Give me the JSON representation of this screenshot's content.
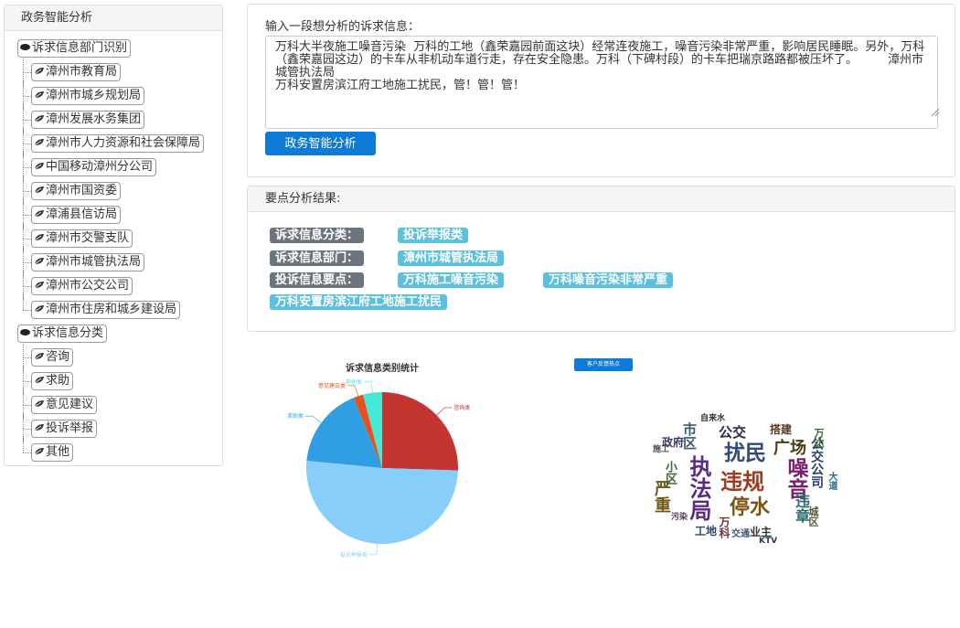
{
  "sidebar": {
    "title": "政务智能分析",
    "groups": [
      {
        "label": "诉求信息部门识别",
        "items": [
          "漳州市教育局",
          "漳州市城乡规划局",
          "漳州发展水务集团",
          "漳州市人力资源和社会保障局",
          "中国移动漳州分公司",
          "漳州市国资委",
          "漳浦县信访局",
          "漳州市交警支队",
          "漳州市城管执法局",
          "漳州市公交公司",
          "漳州市住房和城乡建设局"
        ]
      },
      {
        "label": "诉求信息分类",
        "items": [
          "咨询",
          "求助",
          "意见建议",
          "投诉举报",
          "其他"
        ]
      }
    ]
  },
  "input_panel": {
    "label": "输入一段想分析的诉求信息：",
    "value": "万科大半夜施工噪音污染  万科的工地（鑫荣嘉园前面这块）经常连夜施工，噪音污染非常严重，影响居民睡眠。另外，万科（鑫荣嘉园这边）的卡车从非机动车道行走，存在安全隐患。万科（下碑村段）的卡车把瑞京路路都被压坏了。        漳州市城管执法局\n万科安置房滨江府工地施工扰民，管！管！管！",
    "button": "政务智能分析"
  },
  "result_panel": {
    "title": "要点分析结果:",
    "category_label": "诉求信息分类：",
    "category_value": "投诉举报类",
    "department_label": "诉求信息部门：",
    "department_value": "漳州市城管执法局",
    "points_label": "投诉信息要点：",
    "points": [
      "万科施工噪音污染",
      "万科噪音污染非常严重",
      "万科安置房滨江府工地施工扰民"
    ]
  },
  "chart_data": {
    "type": "pie",
    "title": "诉求信息类别统计",
    "labels": [
      "咨询类",
      "投诉举报类",
      "求助类",
      "意见建议类",
      "其他类"
    ],
    "values": [
      25,
      50,
      17,
      2,
      4
    ],
    "colors": [
      "#c23531",
      "#87cefa",
      "#2f9ee2",
      "#e8511a",
      "#48e8d8"
    ]
  },
  "cloud": {
    "button": "客户反馈热点",
    "words": [
      {
        "t": "扰民",
        "c": "#2f4a7c"
      },
      {
        "t": "违规",
        "c": "#a33a1e"
      },
      {
        "t": "停水",
        "c": "#7a5410"
      },
      {
        "t": "噪音",
        "c": "#7a1f6e"
      },
      {
        "t": "执法局",
        "c": "#5b2a86"
      },
      {
        "t": "广场",
        "c": "#4a3c14"
      },
      {
        "t": "公交",
        "c": "#2b2b4d"
      },
      {
        "t": "严重",
        "c": "#6b5a1a"
      },
      {
        "t": "违章",
        "c": "#2a6b6b"
      },
      {
        "t": "公交公司",
        "c": "#2a3f66"
      },
      {
        "t": "市区",
        "c": "#3a5a78"
      },
      {
        "t": "万达",
        "c": "#3a6a3a"
      },
      {
        "t": "业主",
        "c": "#333333"
      },
      {
        "t": "搭建",
        "c": "#5a3a20"
      },
      {
        "t": "小区",
        "c": "#3a6a3a"
      },
      {
        "t": "工地",
        "c": "#2a4a6a"
      },
      {
        "t": "政府",
        "c": "#3a3a6a"
      },
      {
        "t": "自来水",
        "c": "#333333"
      },
      {
        "t": "施工",
        "c": "#4a4a4a"
      },
      {
        "t": "交通",
        "c": "#3a5a7a"
      },
      {
        "t": "KTV",
        "c": "#2a3a5a"
      },
      {
        "t": "污染",
        "c": "#5a3a5a"
      },
      {
        "t": "城区",
        "c": "#5a5a3a"
      },
      {
        "t": "万科",
        "c": "#6a3a3a"
      },
      {
        "t": "大道",
        "c": "#2a6a8a"
      }
    ]
  }
}
